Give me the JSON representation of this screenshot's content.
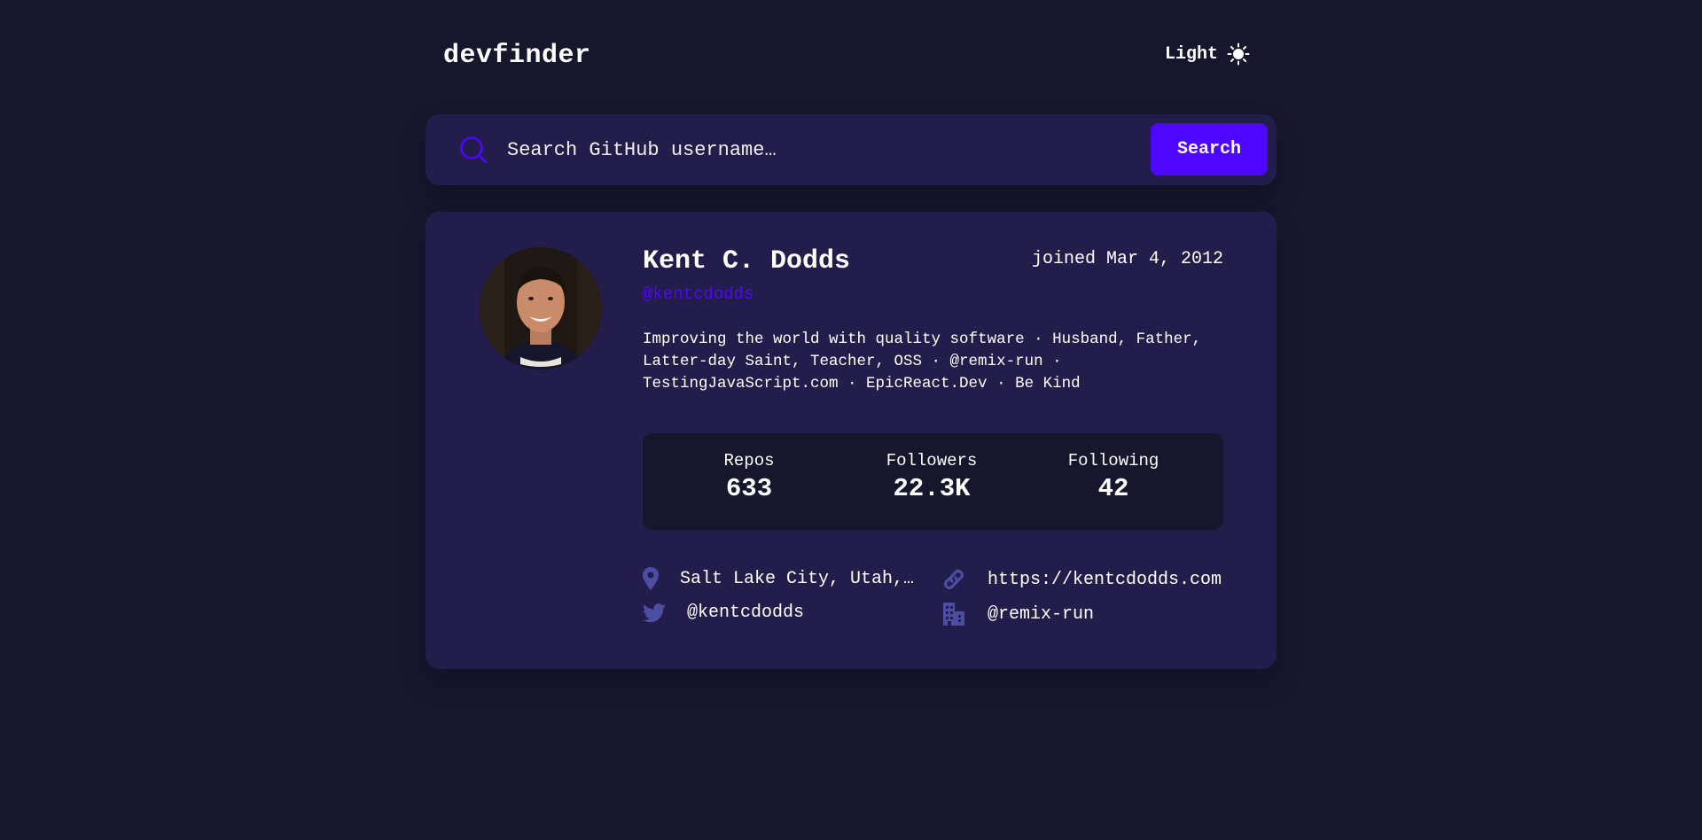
{
  "app": {
    "logo": "devfinder",
    "theme_toggle_label": "Light"
  },
  "search": {
    "placeholder": "Search GitHub username…",
    "value": "",
    "button_label": "Search"
  },
  "profile": {
    "name": "Kent C. Dodds",
    "joined": "joined Mar 4, 2012",
    "login": "@kentcdodds",
    "bio_lines": [
      "Improving the world with quality software · Husband, Father,",
      "Latter-day Saint, Teacher, OSS · @remix-run ·",
      "TestingJavaScript.com · EpicReact.Dev · Be Kind"
    ],
    "stats": [
      {
        "label": "Repos",
        "value": "633"
      },
      {
        "label": "Followers",
        "value": "22.3K"
      },
      {
        "label": "Following",
        "value": "42"
      }
    ],
    "links": {
      "location": "Salt Lake City, Utah,…",
      "website": "https://kentcdodds.com",
      "twitter": "@kentcdodds",
      "company": "@remix-run"
    }
  },
  "icons": {
    "theme": "sun-icon",
    "search": "search-icon",
    "location": "location-pin-icon",
    "website": "link-icon",
    "twitter": "twitter-icon",
    "company": "building-icon"
  },
  "colors": {
    "background": "#16162d",
    "card": "#231d4b",
    "accent": "#4d07ff",
    "text": "#ffffff",
    "icon": "#4c4ea3"
  }
}
